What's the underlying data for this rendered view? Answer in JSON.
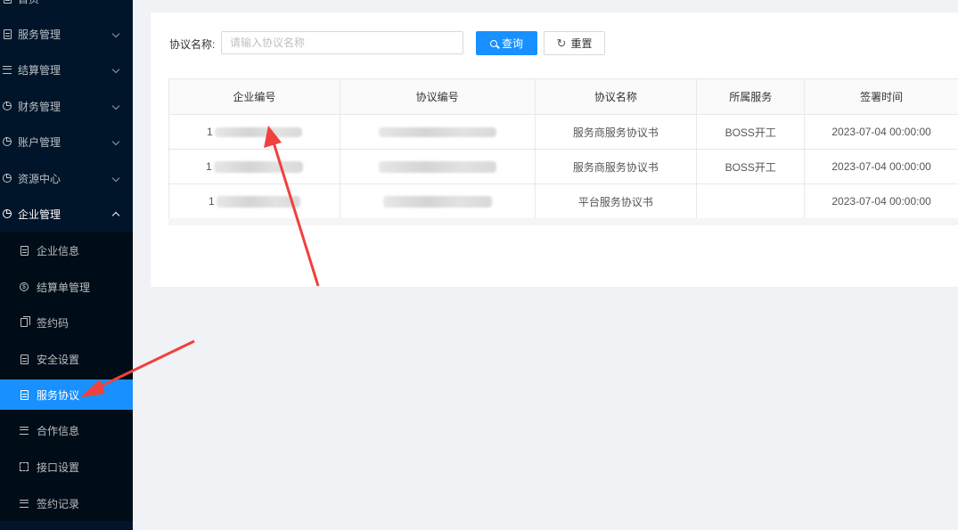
{
  "sidebar": {
    "top_partial": "首页",
    "menus": [
      {
        "label": "服务管理",
        "icon": "document-icon"
      },
      {
        "label": "结算管理",
        "icon": "list-icon"
      },
      {
        "label": "财务管理",
        "icon": "pie-chart-icon"
      },
      {
        "label": "账户管理",
        "icon": "pie-chart-icon"
      },
      {
        "label": "资源中心",
        "icon": "pie-chart-icon"
      },
      {
        "label": "企业管理",
        "icon": "pie-chart-icon"
      }
    ],
    "submenu": [
      {
        "label": "企业信息",
        "icon": "document-icon"
      },
      {
        "label": "结算单管理",
        "icon": "coin-icon"
      },
      {
        "label": "签约码",
        "icon": "copy-icon"
      },
      {
        "label": "安全设置",
        "icon": "document-icon"
      },
      {
        "label": "服务协议",
        "icon": "document-icon",
        "active": true
      },
      {
        "label": "合作信息",
        "icon": "list-icon"
      },
      {
        "label": "接口设置",
        "icon": "bracket-icon"
      },
      {
        "label": "签约记录",
        "icon": "list-icon"
      }
    ]
  },
  "search": {
    "label": "协议名称:",
    "placeholder": "请输入协议名称",
    "value": "",
    "query_label": "查询",
    "reset_label": "重置"
  },
  "table": {
    "columns": [
      "企业编号",
      "协议编号",
      "协议名称",
      "所属服务",
      "签署时间"
    ],
    "rows": [
      {
        "company_id_prefix": "1",
        "agreement_name": "服务商服务协议书",
        "service": "BOSS开工",
        "signed_at": "2023-07-04 00:00:00"
      },
      {
        "company_id_prefix": "1",
        "agreement_name": "服务商服务协议书",
        "service": "BOSS开工",
        "signed_at": "2023-07-04 00:00:00"
      },
      {
        "company_id_prefix": "1",
        "agreement_name": "平台服务协议书",
        "service": "",
        "signed_at": "2023-07-04 00:00:00"
      }
    ]
  },
  "colors": {
    "sidebar_bg": "#001529",
    "submenu_bg": "#000c17",
    "accent": "#1890ff",
    "annotation_arrow": "#f0413c"
  }
}
